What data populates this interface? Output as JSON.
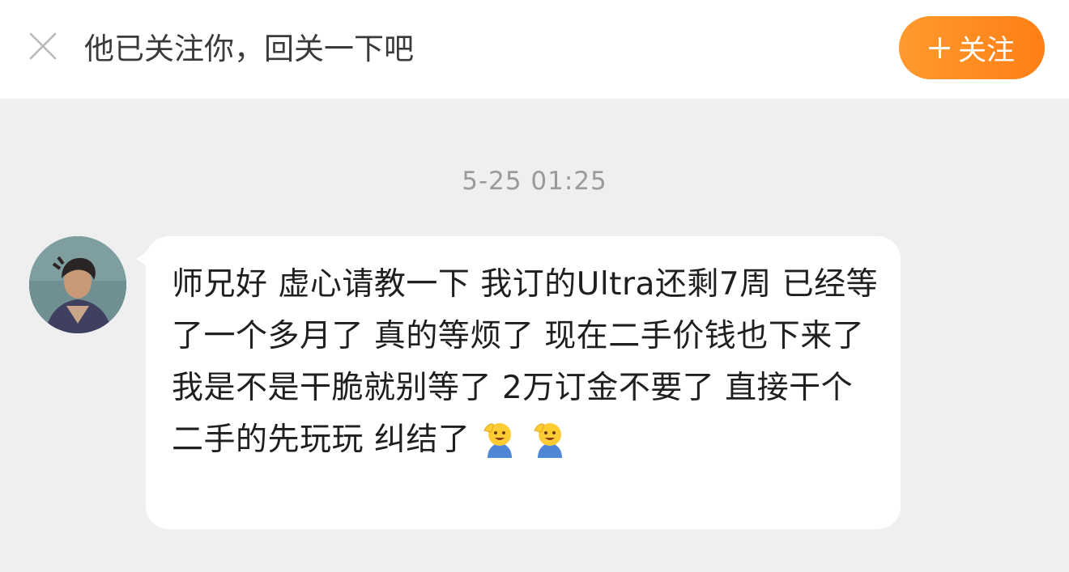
{
  "top_bar": {
    "prompt_text": "他已关注你，回关一下吧",
    "follow_button_label": "关注",
    "close_icon": "close-icon",
    "plus_icon": "plus-icon"
  },
  "conversation": {
    "timestamp": "5-25 01:25",
    "message": {
      "text": "师兄好 虚心请教一下 我订的Ultra还剩7周 已经等了一个多月了 真的等烦了 现在二手价钱也下来了 我是不是干脆就别等了 2万订金不要了 直接干个二手的先玩玩 纠结了",
      "emojis": [
        "salute-emoji",
        "salute-emoji"
      ]
    }
  },
  "colors": {
    "accent": "#ff8c1f",
    "background": "#efefef",
    "bubble": "#ffffff"
  }
}
